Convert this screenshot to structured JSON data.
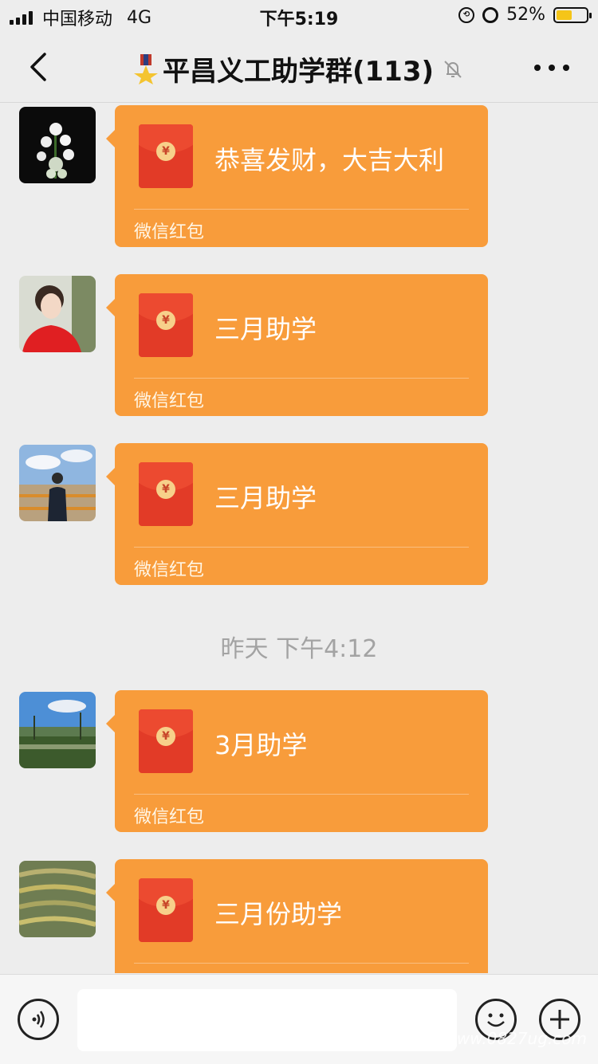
{
  "status_bar": {
    "carrier": "中国移动",
    "network": "4G",
    "time": "下午5:19",
    "battery_percent": "52%",
    "battery_level": 0.52,
    "battery_color": "#f5c518",
    "icons": [
      "signal-icon",
      "rotation-lock-icon",
      "alarm-icon",
      "battery-icon"
    ]
  },
  "nav": {
    "title": "平昌义工助学群(113)",
    "title_icon": "medal-icon",
    "muted_icon": "bell-off-icon",
    "back_icon": "chevron-left-icon",
    "more_icon": "more-dots-icon"
  },
  "messages": [
    {
      "type": "red-packet",
      "avatar": "avatar-flowers",
      "title": "恭喜发财，大吉大利",
      "label": "微信红包"
    },
    {
      "type": "red-packet",
      "avatar": "avatar-woman-red",
      "title": "三月助学",
      "label": "微信红包"
    },
    {
      "type": "red-packet",
      "avatar": "avatar-man-landscape",
      "title": "三月助学",
      "label": "微信红包"
    },
    {
      "type": "timestamp",
      "text": "昨天 下午4:12"
    },
    {
      "type": "red-packet",
      "avatar": "avatar-field-sky",
      "title": "3月助学",
      "label": "微信红包"
    },
    {
      "type": "red-packet",
      "avatar": "avatar-terraces",
      "title": "三月份助学",
      "label": ""
    }
  ],
  "colors": {
    "bubble": "#f89c3b",
    "envelope": "#e23b27",
    "background": "#ededed"
  },
  "input_bar": {
    "voice_icon": "voice-icon",
    "emoji_icon": "emoji-icon",
    "plus_icon": "plus-icon"
  },
  "watermark": "www.0827ug.com"
}
